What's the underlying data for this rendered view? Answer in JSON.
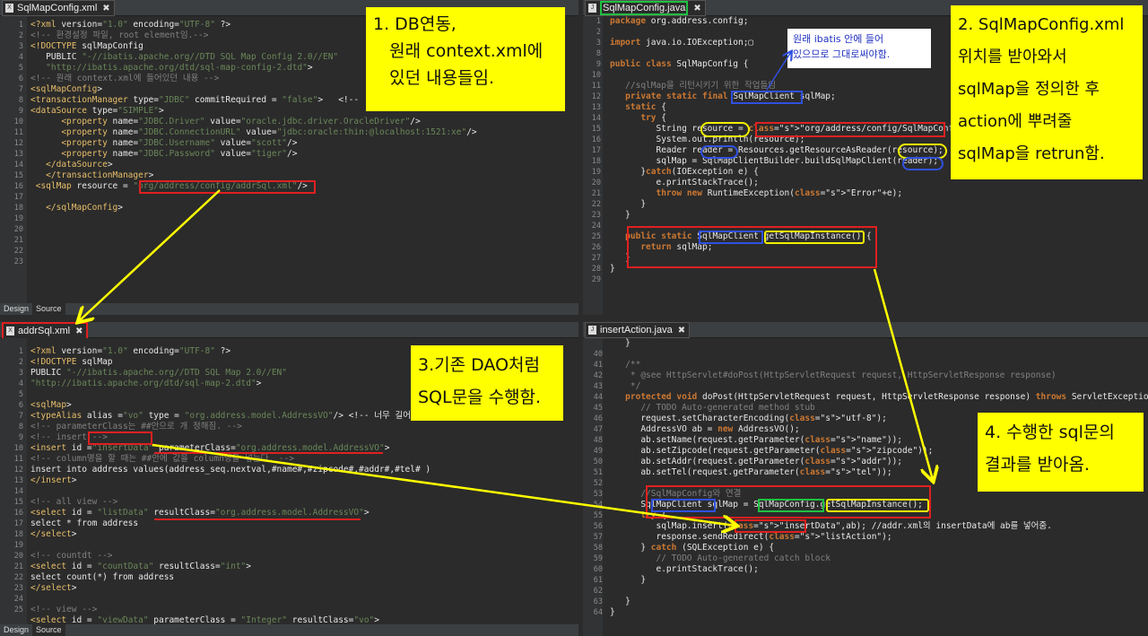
{
  "panes": {
    "xml_config": {
      "tab": "SqlMapConfig.xml",
      "bottom_tabs": [
        "Design",
        "Source"
      ],
      "line_numbers": [
        "1",
        "2",
        "3",
        "4",
        "5",
        "6",
        "7",
        "8",
        "9",
        "10",
        "11",
        "12",
        "13",
        "14",
        "15",
        "16",
        "17",
        "18",
        "19",
        "20",
        "21",
        "22",
        "23"
      ],
      "code": [
        "<?xml version=\"1.0\" encoding=\"UTF-8\" ?>",
        "<!-- 환경설정 파일, root element임.-->",
        "<!DOCTYPE sqlMapConfig",
        "   PUBLIC \"-//ibatis.apache.org//DTD SQL Map Config 2.0//EN\"",
        "   \"http://ibatis.apache.org/dtd/sql-map-config-2.dtd\">",
        "<!-- 원래 context.xml에 들어있던 내용 -->",
        "<sqlMapConfig>",
        "<transactionManager type=\"JDBC\" commitRequired = \"false\">   <!--",
        "<dataSource type=\"SIMPLE\">",
        "      <property name=\"JDBC.Driver\" value=\"oracle.jdbc.driver.OracleDriver\"/>",
        "      <property name=\"JDBC.ConnectionURL\" value=\"jdbc:oracle:thin:@localhost:1521:xe\"/>",
        "      <property name=\"JDBC.Username\" value=\"scott\"/>",
        "      <property name=\"JDBC.Password\" value=\"tiger\"/>",
        "   </dataSource>",
        "   </transactionManager>",
        " <sqlMap resource = \"org/address/config/addrSql.xml\"/>",
        "",
        "   </sqlMapConfig>",
        "",
        "",
        "",
        "",
        ""
      ]
    },
    "java_config": {
      "tab": "SqlMapConfig.java",
      "line_numbers": [
        "1",
        "2",
        "3",
        "8",
        "9",
        "10",
        "11",
        "12",
        "13",
        "14",
        "15",
        "16",
        "17",
        "18",
        "19",
        "20",
        "21",
        "22",
        "23",
        "24",
        "25",
        "26",
        "27",
        "28",
        "29"
      ],
      "code": [
        "package org.address.config;",
        "",
        "import java.io.IOException;▢",
        "",
        "public class SqlMapConfig {",
        "",
        "   //sqlMap을 리턴시키기 위한 작업들임",
        "   private static final SqlMapClient sqlMap;",
        "   static {",
        "      try {",
        "         String resource = \"org/address/config/SqlMapConfig.xml\";",
        "         System.out.println(resource);",
        "         Reader reader = Resources.getResourceAsReader(resource);",
        "         sqlMap = SqlMapClientBuilder.buildSqlMapClient(reader);",
        "      }catch(IOException e) {",
        "         e.printStackTrace();",
        "         throw new RuntimeException(\"Error\"+e);",
        "      }",
        "   }",
        "",
        "   public static SqlMapClient getSqlMapInstance() {",
        "      return sqlMap;",
        "   }",
        "}",
        ""
      ]
    },
    "xml_sql": {
      "tab": "addrSql.xml",
      "bottom_tabs": [
        "Design",
        "Source"
      ],
      "line_numbers": [
        "1",
        "2",
        "3",
        "4",
        "5",
        "6",
        "7",
        "8",
        "9",
        "10",
        "11",
        "12",
        "13",
        "14",
        "15",
        "16",
        "17",
        "18",
        "19",
        "20",
        "21",
        "22",
        "23",
        "24",
        "25"
      ],
      "code": [
        "<?xml version=\"1.0\" encoding=\"UTF-8\" ?>",
        "<!DOCTYPE sqlMap",
        "PUBLIC \"-//ibatis.apache.org//DTD SQL Map 2.0//EN\"",
        "\"http://ibatis.apache.org/dtd/sql-map-2.dtd\">",
        "",
        "<sqlMap>",
        "<typeAlias alias =\"vo\" type = \"org.address.model.AddressVO\"/> <!-- 너무 길어서",
        "<!-- parameterClass는 ##안으로 개 정해짐. -->",
        "<!-- insert -->",
        "<insert id =\"insertData\" parameterClass=\"org.address.model.AddressVO\">",
        "<!-- column명을 할 때는 ##안에 값을 column명을 넣는다. -->",
        "insert into address values(address_seq.nextval,#name#,#zipcode#,#addr#,#tel# )",
        "</insert>",
        "",
        "<!-- all view -->",
        "<select id = \"listData\" resultClass=\"org.address.model.AddressVO\">",
        "select * from address",
        "</select>",
        "",
        "<!-- countdt -->",
        "<select id = \"countData\" resultClass=\"int\">",
        "select count(*) from address",
        "</select>",
        "",
        "<!-- view -->"
      ],
      "last_line": "<select id = \"viewData\" parameterClass = \"Integer\" resultClass=\"vo\">"
    },
    "java_action": {
      "tab": "insertAction.java",
      "line_numbers": [
        "",
        "40",
        "41",
        "42",
        "43",
        "44",
        "45",
        "46",
        "47",
        "48",
        "49",
        "50",
        "51",
        "52",
        "53",
        "54",
        "55",
        "56",
        "57",
        "58",
        "59",
        "60",
        "61",
        "62",
        "63",
        "64"
      ],
      "code": [
        "   }",
        "",
        "   /**",
        "    * @see HttpServlet#doPost(HttpServletRequest request, HttpServletResponse response)",
        "    */",
        "   protected void doPost(HttpServletRequest request, HttpServletResponse response) throws ServletException",
        "      // TODO Auto-generated method stub",
        "      request.setCharacterEncoding(\"utf-8\");",
        "      AddressVO ab = new AddressVO();",
        "      ab.setName(request.getParameter(\"name\"));",
        "      ab.setZipcode(request.getParameter(\"zipcode\"));",
        "      ab.setAddr(request.getParameter(\"addr\"));",
        "      ab.setTel(request.getParameter(\"tel\"));",
        "",
        "      //SqlMapConfig와 연결",
        "      SqlMapClient sqlMap = SqlMapConfig.getSqlMapInstance();",
        "      try {",
        "         sqlMap.insert(\"insertData\",ab); //addr.xml의 insertData에 ab를 넣어줌.",
        "         response.sendRedirect(\"listAction\");",
        "      } catch (SQLException e) {",
        "         // TODO Auto-generated catch block",
        "         e.printStackTrace();",
        "      }",
        "",
        "   }",
        "}"
      ]
    }
  },
  "notes": {
    "n1": "1. DB연동,\n   원래 context.xml에\n   있던 내용들임.",
    "n2": "2. SqlMapConfig.xml\n위치를 받아와서\nsqlMap을 정의한 후\naction에 뿌려줄\nsqlMap을 retrun함.",
    "n3": "3.기존 DAO처럼\nSQL문을 수행함.",
    "n4": "4. 수행한 sql문의\n결과를 받아옴.",
    "ibatis": "원래 ibatis 안에 들어\n있으므로 그대로써야함."
  },
  "colors": {
    "highlight": "#ffff00",
    "box_red": "#e02020",
    "box_blue": "#3050e0",
    "box_yellow": "#f0f000",
    "box_green": "#20c040"
  }
}
